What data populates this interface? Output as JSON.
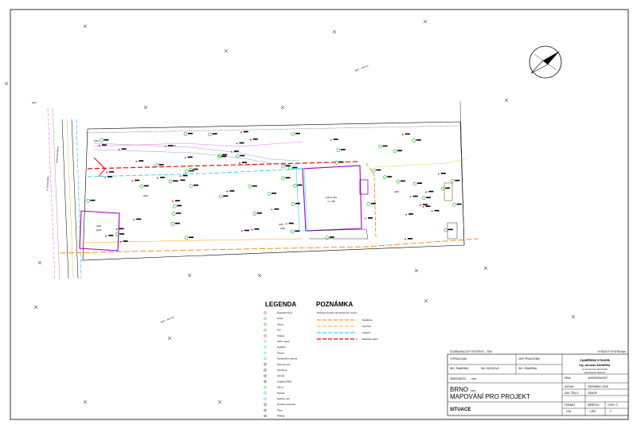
{
  "sheet": {
    "title": "SITUACE"
  },
  "plan": {
    "building_main": {
      "label": "rodinný dům",
      "sub": "č.p. 258"
    },
    "building_left": {
      "label": "4008",
      "sub": "garáž"
    },
    "parcels": [
      "4002",
      "4003",
      "4005",
      "4004",
      "4006",
      "4007",
      "4009"
    ],
    "road_labels": [
      "ul. Komenského",
      "místní komunikace"
    ],
    "coords": [
      "4821 .. 430 010",
      "4819 .. 430 220"
    ],
    "north_symbol": "north-arrow"
  },
  "legend": {
    "heading": "LEGENDA",
    "items": [
      "Podrobný bod",
      "Strom",
      "Sloup",
      "Keř",
      "Poklop",
      "Uliční vpusť",
      "Hydrant",
      "Šoupě",
      "Kanalizační šachta",
      "Plotová zeď",
      "Obrubník",
      "Lampa",
      "Značka (PBZ)",
      "Vjezd",
      "Šachta",
      "Sedlový štít",
      "Hranice pozemku",
      "Ploty",
      "Pěšina"
    ]
  },
  "notes": {
    "heading": "POZNÁMKA",
    "intro": "Polohopis zaměřen dle skutečnosti v terénu",
    "lines": [
      "Kanalizace",
      "Plynovod",
      "Vodovod",
      "Elektrické vedení"
    ]
  },
  "titleblock": {
    "coord_system_left": "SOUŘADNICOVÝ SYSTÉM S - JTSK",
    "coord_system_right": "VÝŠKOVÝ SYSTÉM Bpv",
    "vypracoval_label": "VYPRACOVAL",
    "vypracoval_name": "ING. ŠAVARINA",
    "kontroloval_name": "ING. BOJKOVÁ",
    "odp_label": "ODP. PRACOVNÍK",
    "odp_name": "ING. ŠAVARINA",
    "company_line1": "ZAMĚŘENÍ STAVEB",
    "company_line2": "Ing. Jaroslav ŠAVARINA",
    "company_line3": "tel. 541 211 131, 602 123 456",
    "company_line4": "www.zamereni-staveb.cz",
    "objednatel_label": "OBJEDNATEL",
    "objednatel_value": "xxxx",
    "city": "BRNO",
    "city_suffix": "xxxx",
    "project": "MAPOVÁNÍ PRO PROJEKT",
    "drawing": "SITUACE",
    "kraj_label": "KRAJ",
    "kraj_value": "JIHOMORAVSKÝ",
    "datum_label": "DATUM",
    "datum_value": "ČERVENEC 2005",
    "zak_label": "ZAK. ČÍSLO",
    "zak_value": "2005/29",
    "format_label": "FORMÁT",
    "format_value": "2 A4",
    "meritko_label": "MĚŘÍTKO",
    "meritko_value": "1:200",
    "vykres_label": "VÝKR. Č.",
    "vykres_value": "2"
  }
}
